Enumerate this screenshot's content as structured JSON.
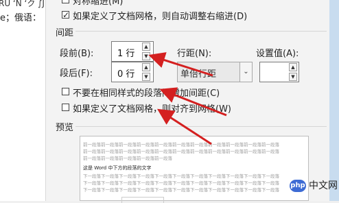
{
  "doc": {
    "line1": "RU ‘N ‘ク ∫J",
    "line2": "e；俄语："
  },
  "checkbox_top": {
    "label": "对称缩进(M)",
    "checked": false
  },
  "checkbox_grid_right": {
    "label": "如果定义了文档网格，则自动调整右缩进(D)",
    "checked": true
  },
  "spacing": {
    "section_title": "间距",
    "before_label": "段前(B):",
    "before_value": "1 行",
    "after_label": "段后(F):",
    "after_value": "0 行",
    "line_spacing_label": "行距(N):",
    "line_spacing_value": "单倍行距",
    "setting_label": "设置值(A):",
    "setting_value": ""
  },
  "checkbox_no_space": {
    "label": "不要在相同样式的段落间增加间距(C)",
    "checked": false
  },
  "checkbox_align_grid": {
    "label": "如果定义了文档网格，则对齐到网格(W)",
    "checked": false
  },
  "preview": {
    "section_title": "预览",
    "prev_line": "前一段落前一段落前一段落前一段落前一段落前一段落前一段落前一段落前一段落前一段落前一段落",
    "prev_line2": "前一段落前一段落前一段落前一段落前一段落",
    "sample_text": "这是 Word 中下方的段落的文字",
    "next_line": "下一段落下一段落下一段落下一段落下一段落下一段落下一段落下一段落下一段落下一段落下一段落"
  },
  "watermark": {
    "badge": "php",
    "text": "中文网"
  },
  "colors": {
    "arrow": "#d42020",
    "accent": "#3d6bd4"
  }
}
